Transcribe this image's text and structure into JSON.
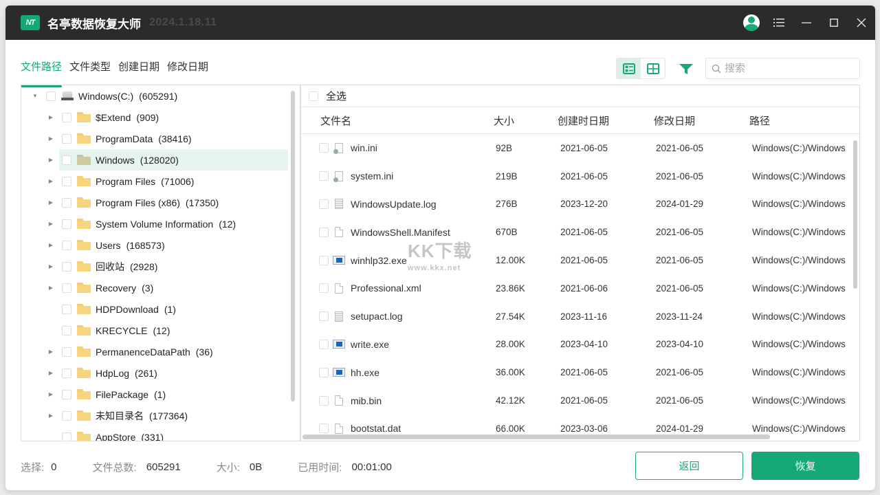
{
  "titlebar": {
    "logo_text": "NT",
    "title": "名亭数据恢复大师",
    "version": "2024.1.18.11",
    "controls": [
      "user-avatar",
      "menu",
      "minimize",
      "maximize",
      "close"
    ]
  },
  "tabs": [
    {
      "label": "文件路径",
      "active": true
    },
    {
      "label": "文件类型",
      "active": false
    },
    {
      "label": "创建日期",
      "active": false
    },
    {
      "label": "修改日期",
      "active": false
    }
  ],
  "toolbar": {
    "view_modes": [
      "list-view",
      "grid-view"
    ],
    "active_view": "list-view",
    "search_placeholder": "搜索",
    "search_value": ""
  },
  "tree": {
    "root": {
      "name": "Windows(C:)",
      "count": "(605291)",
      "expanded": true
    },
    "items": [
      {
        "name": "$Extend",
        "count": "(909)",
        "has_children": true,
        "selected": false
      },
      {
        "name": "ProgramData",
        "count": "(38416)",
        "has_children": true,
        "selected": false
      },
      {
        "name": "Windows",
        "count": "(128020)",
        "has_children": true,
        "selected": true
      },
      {
        "name": "Program Files",
        "count": "(71006)",
        "has_children": true,
        "selected": false
      },
      {
        "name": "Program Files (x86)",
        "count": "(17350)",
        "has_children": true,
        "selected": false
      },
      {
        "name": "System Volume Information",
        "count": "(12)",
        "has_children": true,
        "selected": false
      },
      {
        "name": "Users",
        "count": "(168573)",
        "has_children": true,
        "selected": false
      },
      {
        "name": "回收站",
        "count": "(2928)",
        "has_children": true,
        "selected": false
      },
      {
        "name": "Recovery",
        "count": "(3)",
        "has_children": true,
        "selected": false
      },
      {
        "name": "HDPDownload",
        "count": "(1)",
        "has_children": false,
        "selected": false
      },
      {
        "name": "KRECYCLE",
        "count": "(12)",
        "has_children": false,
        "selected": false
      },
      {
        "name": "PermanenceDataPath",
        "count": "(36)",
        "has_children": true,
        "selected": false
      },
      {
        "name": "HdpLog",
        "count": "(261)",
        "has_children": true,
        "selected": false
      },
      {
        "name": "FilePackage",
        "count": "(1)",
        "has_children": true,
        "selected": false
      },
      {
        "name": "未知目录名",
        "count": "(177364)",
        "has_children": true,
        "selected": false
      },
      {
        "name": "AppStore",
        "count": "(331)",
        "has_children": false,
        "selected": false
      }
    ]
  },
  "files": {
    "select_all_label": "全选",
    "columns": [
      "文件名",
      "大小",
      "创建时日期",
      "修改日期",
      "路径"
    ],
    "rows": [
      {
        "icon": "ini",
        "name": "win.ini",
        "size": "92B",
        "created": "2021-06-05",
        "modified": "2021-06-05",
        "path": "Windows(C:)/Windows"
      },
      {
        "icon": "ini",
        "name": "system.ini",
        "size": "219B",
        "created": "2021-06-05",
        "modified": "2021-06-05",
        "path": "Windows(C:)/Windows"
      },
      {
        "icon": "log",
        "name": "WindowsUpdate.log",
        "size": "276B",
        "created": "2023-12-20",
        "modified": "2024-01-29",
        "path": "Windows(C:)/Windows"
      },
      {
        "icon": "doc",
        "name": "WindowsShell.Manifest",
        "size": "670B",
        "created": "2021-06-05",
        "modified": "2021-06-05",
        "path": "Windows(C:)/Windows"
      },
      {
        "icon": "exe",
        "name": "winhlp32.exe",
        "size": "12.00K",
        "created": "2021-06-05",
        "modified": "2021-06-05",
        "path": "Windows(C:)/Windows"
      },
      {
        "icon": "doc",
        "name": "Professional.xml",
        "size": "23.86K",
        "created": "2021-06-06",
        "modified": "2021-06-05",
        "path": "Windows(C:)/Windows"
      },
      {
        "icon": "log",
        "name": "setupact.log",
        "size": "27.54K",
        "created": "2023-11-16",
        "modified": "2023-11-24",
        "path": "Windows(C:)/Windows"
      },
      {
        "icon": "exe",
        "name": "write.exe",
        "size": "28.00K",
        "created": "2023-04-10",
        "modified": "2023-04-10",
        "path": "Windows(C:)/Windows"
      },
      {
        "icon": "exe",
        "name": "hh.exe",
        "size": "36.00K",
        "created": "2021-06-05",
        "modified": "2021-06-05",
        "path": "Windows(C:)/Windows"
      },
      {
        "icon": "doc",
        "name": "mib.bin",
        "size": "42.12K",
        "created": "2021-06-05",
        "modified": "2021-06-05",
        "path": "Windows(C:)/Windows"
      },
      {
        "icon": "doc",
        "name": "bootstat.dat",
        "size": "66.00K",
        "created": "2023-03-06",
        "modified": "2024-01-29",
        "path": "Windows(C:)/Windows"
      }
    ]
  },
  "watermark": {
    "text": "KK下载",
    "sub": "www.kkx.net"
  },
  "status": {
    "selected_label": "选择:",
    "selected_value": "0",
    "total_label": "文件总数:",
    "total_value": "605291",
    "size_label": "大小:",
    "size_value": "0B",
    "elapsed_label": "已用时间:",
    "elapsed_value": "00:01:00"
  },
  "buttons": {
    "back": "返回",
    "recover": "恢复"
  },
  "colors": {
    "accent": "#16a877",
    "titlebar": "#2b2b2b",
    "selected_row": "#e5f4ee",
    "folder": "#f7d57e"
  }
}
